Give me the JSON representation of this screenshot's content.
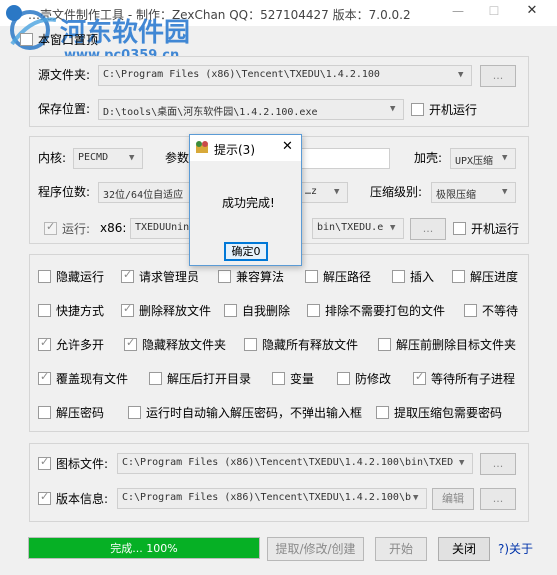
{
  "window": {
    "title": "…壳文件制作工具 - 制作：ZexChan  QQ：527104427  版本：7.0.0.2"
  },
  "watermark": {
    "name": "河东软件园",
    "url": "www.pc0359.cn"
  },
  "top": {
    "always_on_top_label": "本窗口置顶",
    "always_on_top_checked": false
  },
  "source": {
    "label": "源文件夹:",
    "value": "C:\\Program Files (x86)\\Tencent\\TXEDU\\1.4.2.100",
    "browse_label": "..."
  },
  "save": {
    "label": "保存位置:",
    "value": "D:\\tools\\桌面\\河东软件园\\1.4.2.100.exe",
    "autostart_label": "开机运行",
    "autostart_checked": false
  },
  "settings": {
    "kernel_label": "内核:",
    "kernel_value": "PECMD",
    "params_label": "参数",
    "params_value": "",
    "shell_label": "加壳:",
    "shell_value": "UPX压缩",
    "bits_label": "程序位数:",
    "bits_value": "32位/64位自适应",
    "mid_combo_value": "…z",
    "compress_label": "压缩级别:",
    "compress_value": "极限压缩",
    "run_label": "运行:",
    "run_checked": true,
    "x86_label": "x86:",
    "x86_value": "TXEDUUnins…",
    "run_path_value": "bin\\TXEDU.e",
    "run_browse": "...",
    "run_autostart_label": "开机运行",
    "run_autostart_checked": false
  },
  "options": [
    [
      {
        "label": "隐藏运行",
        "checked": false
      },
      {
        "label": "请求管理员",
        "checked": true
      },
      {
        "label": "兼容算法",
        "checked": false
      },
      {
        "label": "解压路径",
        "checked": false
      },
      {
        "label": "插入",
        "checked": false
      },
      {
        "label": "解压进度",
        "checked": false
      }
    ],
    [
      {
        "label": "快捷方式",
        "checked": false
      },
      {
        "label": "删除释放文件",
        "checked": true
      },
      {
        "label": "自我删除",
        "checked": false
      },
      {
        "label": "排除不需要打包的文件",
        "checked": false
      },
      {
        "label": "不等待",
        "checked": false
      }
    ],
    [
      {
        "label": "允许多开",
        "checked": true
      },
      {
        "label": "隐藏释放文件夹",
        "checked": true
      },
      {
        "label": "隐藏所有释放文件",
        "checked": false
      },
      {
        "label": "解压前删除目标文件夹",
        "checked": false
      }
    ],
    [
      {
        "label": "覆盖现有文件",
        "checked": true
      },
      {
        "label": "解压后打开目录",
        "checked": false
      },
      {
        "label": "变量",
        "checked": false
      },
      {
        "label": "防修改",
        "checked": false
      },
      {
        "label": "等待所有子进程",
        "checked": true
      }
    ],
    [
      {
        "label": "解压密码",
        "checked": false
      },
      {
        "label": "运行时自动输入解压密码，不弹出输入框",
        "checked": false
      },
      {
        "label": "提取压缩包需要密码",
        "checked": false
      }
    ]
  ],
  "icon_file": {
    "label": "图标文件:",
    "checked": true,
    "value": "C:\\Program Files (x86)\\Tencent\\TXEDU\\1.4.2.100\\bin\\TXED",
    "browse_label": "..."
  },
  "version_info": {
    "label": "版本信息:",
    "checked": true,
    "value": "C:\\Program Files (x86)\\Tencent\\TXEDU\\1.4.2.100\\b",
    "edit_label": "编辑",
    "browse_label": "..."
  },
  "footer": {
    "progress_text": "完成...  100%",
    "progress_fraction": 1.0,
    "extract_label": "提取/修改/创建",
    "start_label": "开始",
    "close_label": "关闭",
    "about_label": "?)关于"
  },
  "dialog": {
    "title": "提示(3)",
    "message": "成功完成!",
    "ok_label": "确定0"
  },
  "colors": {
    "progress": "#06b025",
    "dialog_border": "#5b9bd5",
    "accent": "#0078d7"
  }
}
